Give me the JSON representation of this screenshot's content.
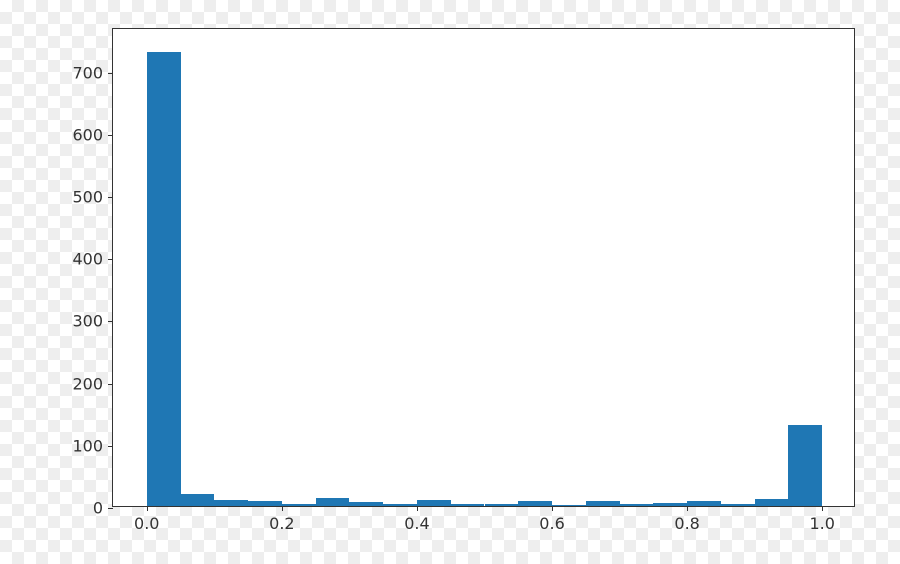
{
  "chart_data": {
    "type": "bar",
    "bins": [
      0.0,
      0.05,
      0.1,
      0.15,
      0.2,
      0.25,
      0.3,
      0.35,
      0.4,
      0.45,
      0.5,
      0.55,
      0.6,
      0.65,
      0.7,
      0.75,
      0.8,
      0.85,
      0.9,
      0.95,
      1.0
    ],
    "values": [
      730,
      20,
      10,
      8,
      3,
      13,
      6,
      3,
      10,
      4,
      3,
      8,
      2,
      8,
      4,
      5,
      8,
      4,
      12,
      130
    ],
    "xlim": [
      -0.05,
      1.05
    ],
    "ylim": [
      0,
      770
    ],
    "xticks": [
      0.0,
      0.2,
      0.4,
      0.6,
      0.8,
      1.0
    ],
    "yticks": [
      0,
      100,
      200,
      300,
      400,
      500,
      600,
      700
    ],
    "title": "",
    "xlabel": "",
    "ylabel": "",
    "bar_color": "#1f77b4"
  },
  "xtick_labels": [
    "0.0",
    "0.2",
    "0.4",
    "0.6",
    "0.8",
    "1.0"
  ],
  "ytick_labels": [
    "0",
    "100",
    "200",
    "300",
    "400",
    "500",
    "600",
    "700"
  ]
}
